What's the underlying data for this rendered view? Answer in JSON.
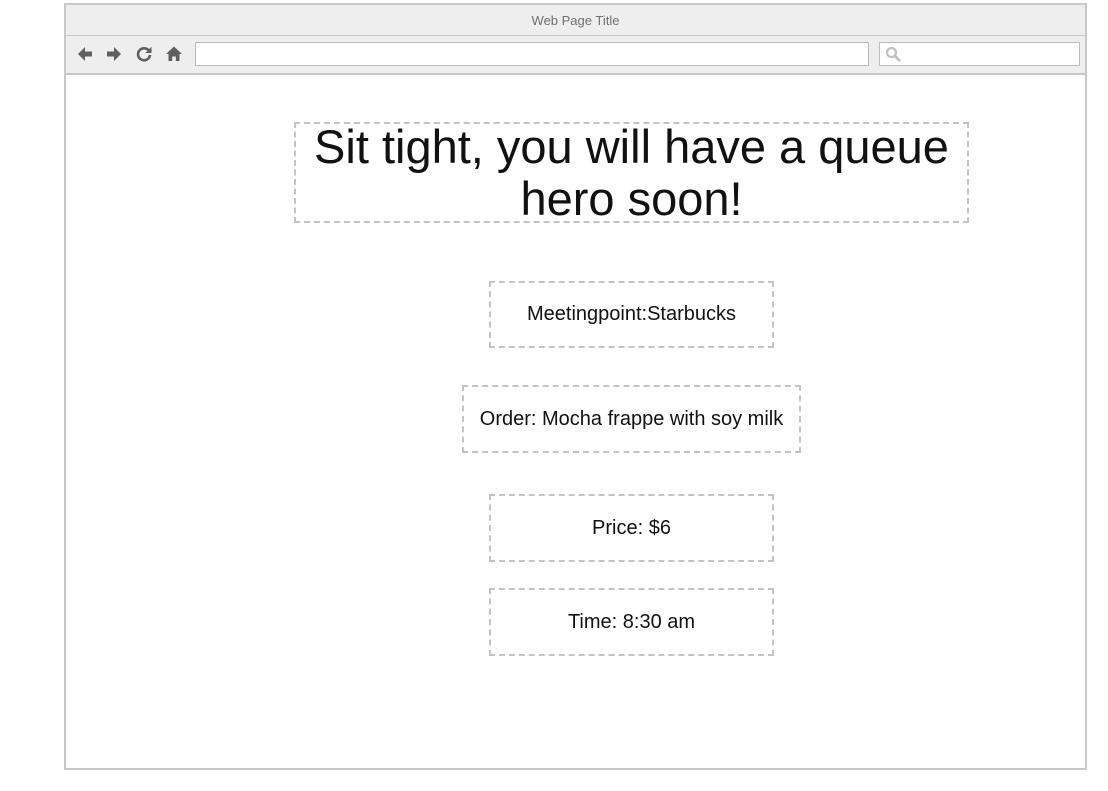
{
  "window": {
    "title": "Web Page Title"
  },
  "toolbar": {
    "buttons": [
      {
        "name": "back-button",
        "icon": "arrow-left-icon"
      },
      {
        "name": "forward-button",
        "icon": "arrow-right-icon"
      },
      {
        "name": "reload-button",
        "icon": "reload-icon"
      },
      {
        "name": "home-button",
        "icon": "home-icon"
      }
    ],
    "address": {
      "value": "",
      "placeholder": ""
    },
    "search": {
      "value": "",
      "placeholder": "",
      "icon": "search-icon"
    }
  },
  "page": {
    "headline": "Sit tight, you will have a queue hero soon!",
    "meeting_point": "Meetingpoint:Starbucks",
    "order": "Order: Mocha frappe with soy milk",
    "price": "Price: $6",
    "time": "Time: 8:30 am"
  },
  "colors": {
    "chrome": "#eeeeee",
    "border": "#c8c8c8",
    "icon": "#606060",
    "dashed_border": "#c4c4c4",
    "text": "#111111"
  }
}
